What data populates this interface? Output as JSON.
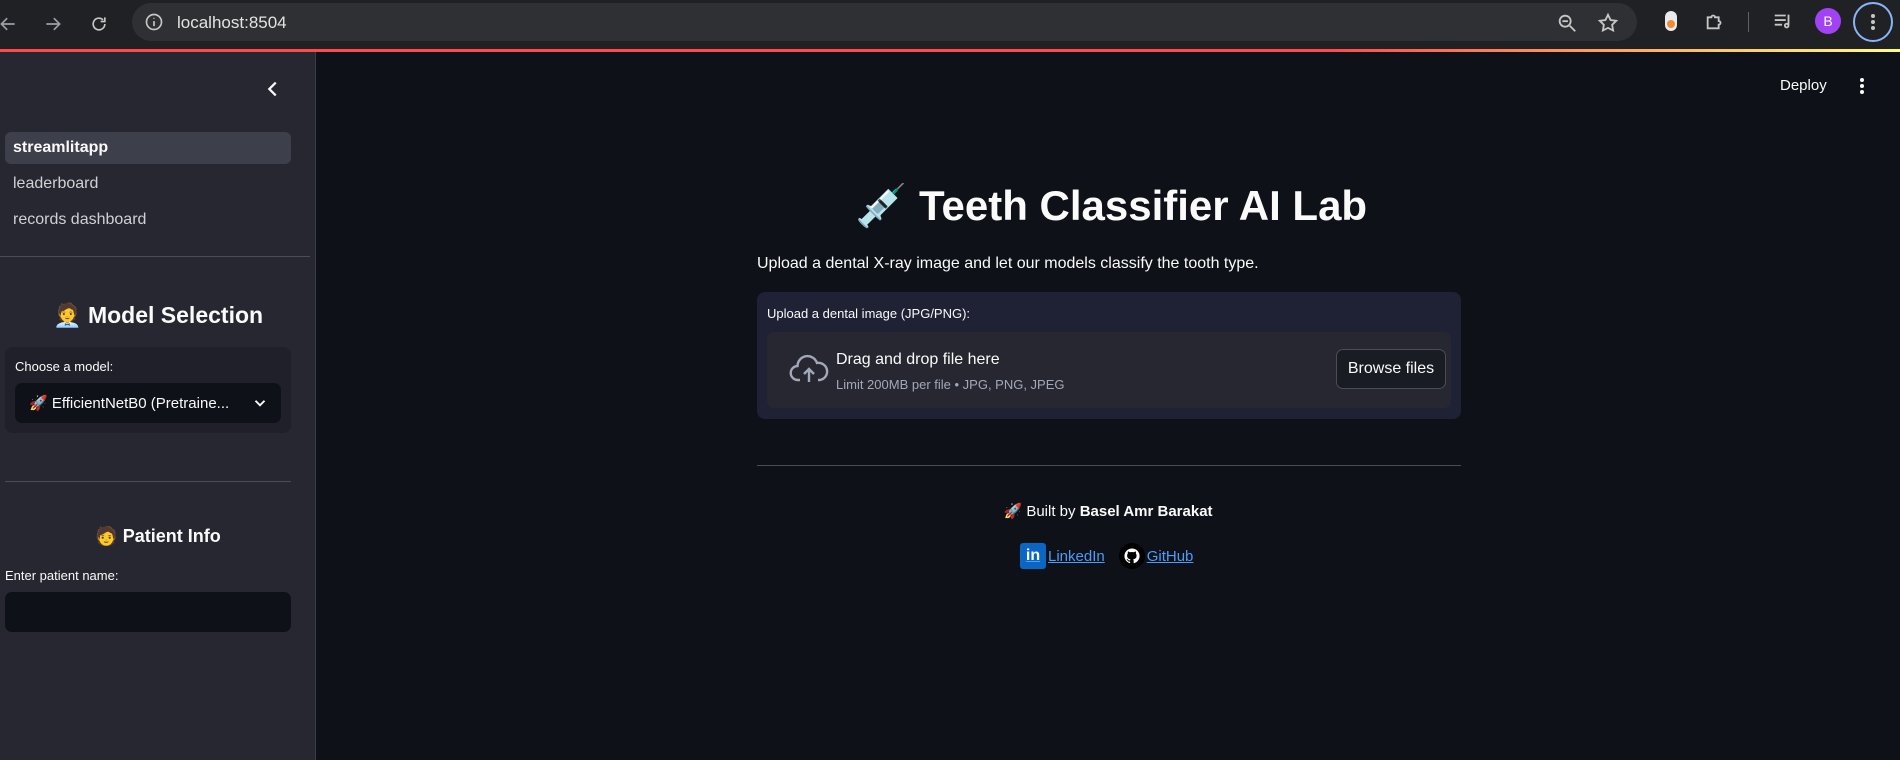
{
  "browser": {
    "url": "localhost:8504",
    "avatar_letter": "B"
  },
  "sidebar": {
    "nav": [
      {
        "label": "streamlitapp",
        "active": true
      },
      {
        "label": "leaderboard",
        "active": false
      },
      {
        "label": "records dashboard",
        "active": false
      }
    ],
    "model_section": {
      "heading_emoji": "🧑‍💼",
      "heading": "Model Selection",
      "select_label": "Choose a model:",
      "selected_emoji": "🚀",
      "selected_value": "EfficientNetB0 (Pretraine..."
    },
    "patient_section": {
      "heading_emoji": "🧑",
      "heading": "Patient Info",
      "input_label": "Enter patient name:",
      "input_value": ""
    }
  },
  "header": {
    "deploy_label": "Deploy"
  },
  "main": {
    "title_emoji": "💉",
    "title": "Teeth Classifier AI Lab",
    "subtitle": "Upload a dental X-ray image and let our models classify the tooth type.",
    "uploader": {
      "label": "Upload a dental image (JPG/PNG):",
      "drag_text": "Drag and drop file here",
      "limit_text": "Limit 200MB per file • JPG, PNG, JPEG",
      "browse_label": "Browse files"
    },
    "footer": {
      "built_emoji": "🚀",
      "built_prefix": "Built by",
      "author": "Basel Amr Barakat",
      "linkedin_label": " LinkedIn ",
      "github_label": " GitHub"
    }
  },
  "colors": {
    "background": "#0e1117",
    "sidebar": "#262730",
    "accent": "#ff4b4b",
    "link": "#4a9cff"
  }
}
